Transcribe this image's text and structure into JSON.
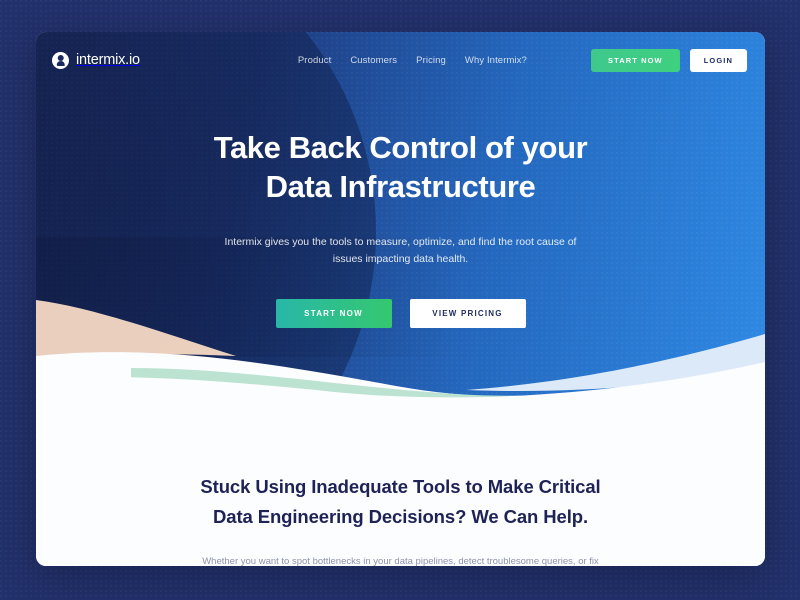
{
  "colors": {
    "page_background": "#22306b",
    "hero_gradient_start": "#1c2d63",
    "hero_gradient_end": "#2f8ae4",
    "accent_green": "#35c86f",
    "accent_teal": "#28b7a8",
    "heading_navy": "#1f2255",
    "wave_peach": "#f7d9c4",
    "wave_mint": "#b5e0cc",
    "wave_light_blue": "#dbe9f8"
  },
  "nav": {
    "brand": {
      "icon": "intermix-circle-logo-icon",
      "name": "intermix.io"
    },
    "links": [
      {
        "label": "Product"
      },
      {
        "label": "Customers"
      },
      {
        "label": "Pricing"
      },
      {
        "label": "Why Intermix?"
      }
    ],
    "start_button": "START NOW",
    "login_button": "LOGIN"
  },
  "hero": {
    "title_line1": "Take Back Control of your",
    "title_line2": "Data Infrastructure",
    "subtitle": "Intermix gives you the tools to measure, optimize, and find the root cause of issues impacting data health.",
    "primary_cta": "START NOW",
    "secondary_cta": "VIEW PRICING"
  },
  "lower": {
    "title_line1": "Stuck Using Inadequate Tools to Make Critical",
    "title_line2": "Data Engineering Decisions? We Can Help.",
    "body": "Whether you want to spot bottlenecks in your data pipelines, detect troublesome queries, or fix slow analytics, intermix.io helps you manage and monitor all"
  }
}
